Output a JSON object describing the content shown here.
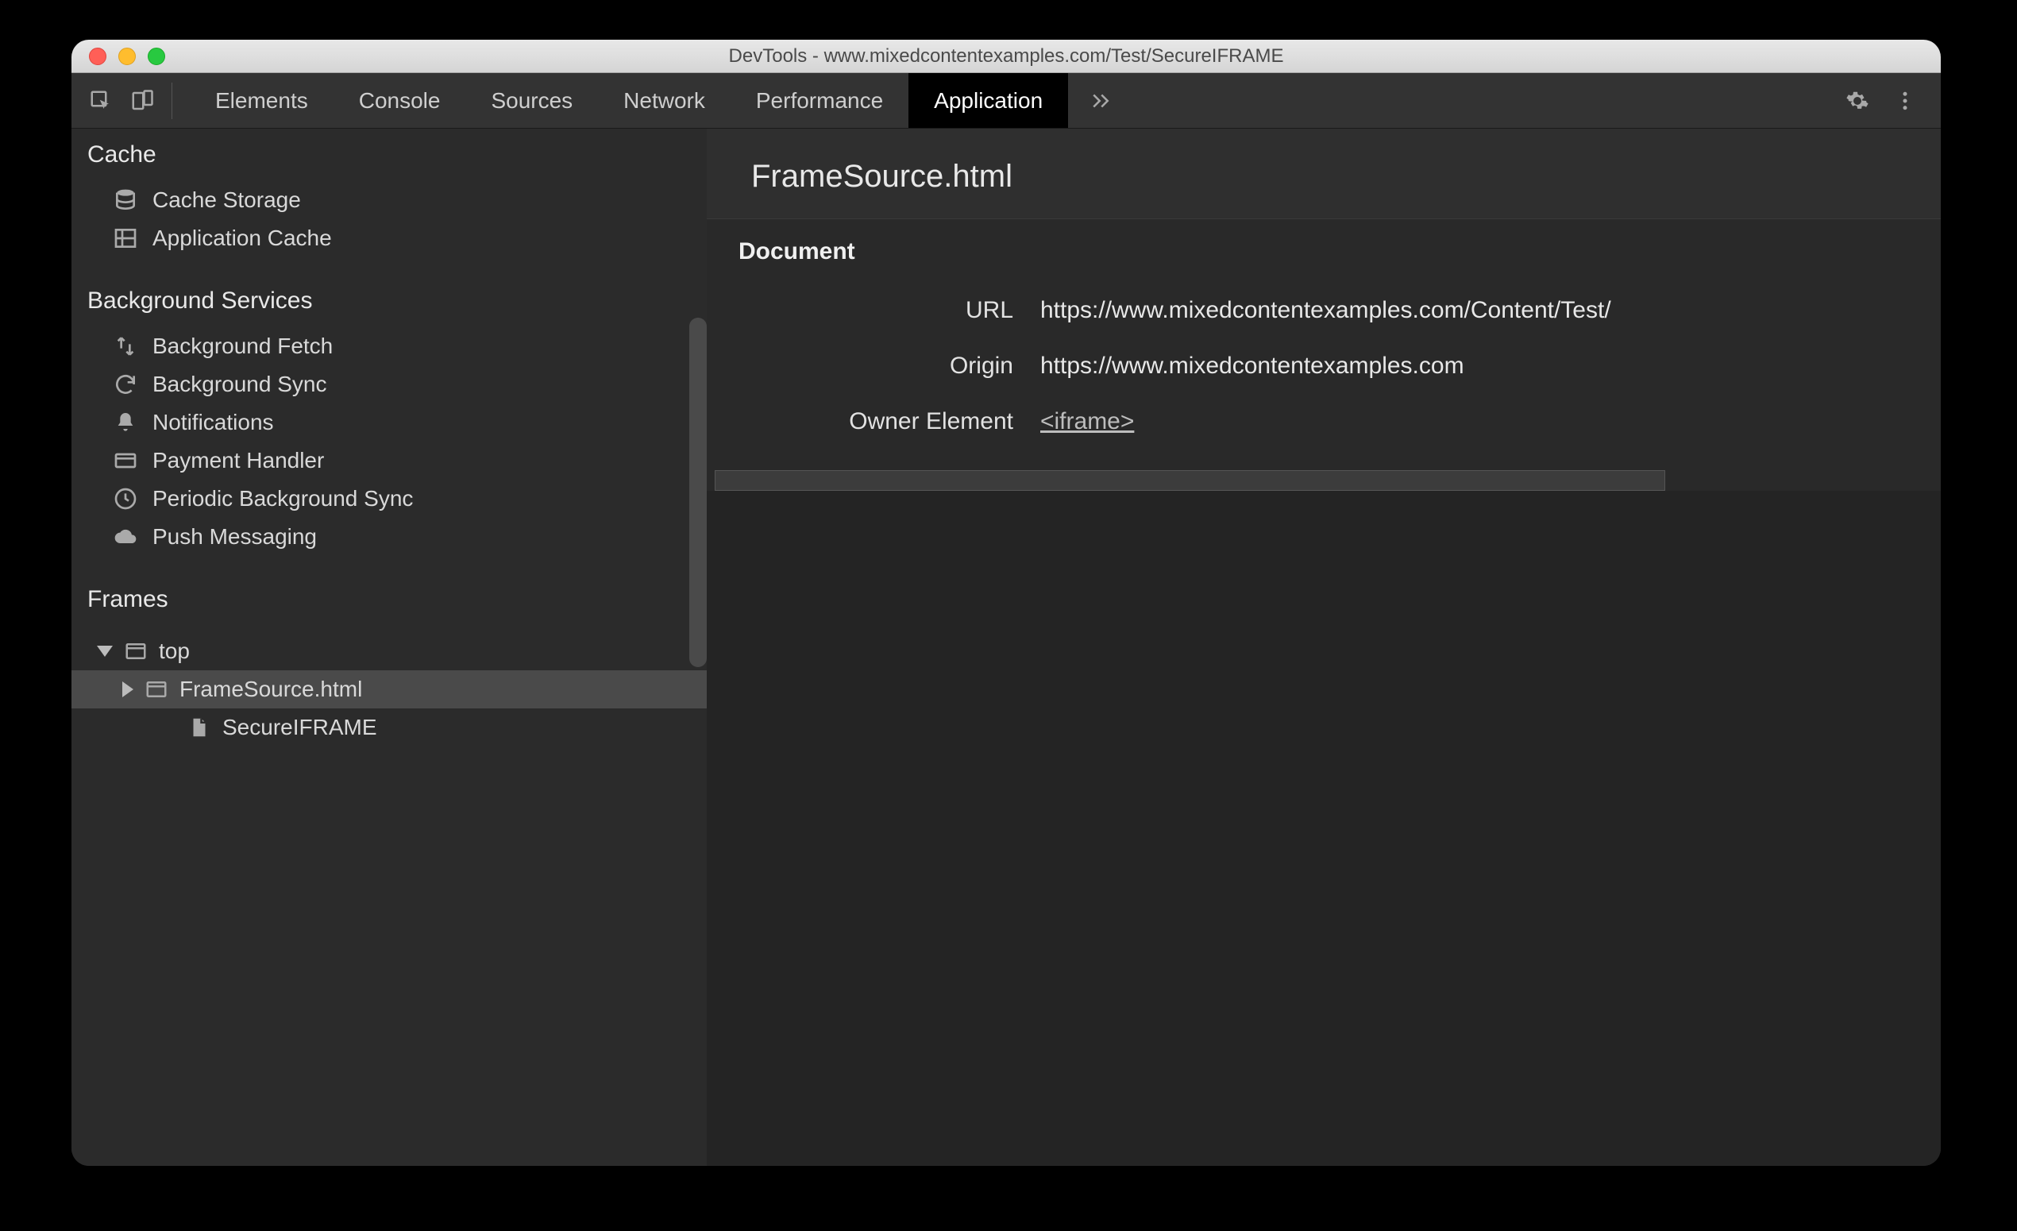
{
  "window": {
    "title": "DevTools - www.mixedcontentexamples.com/Test/SecureIFRAME"
  },
  "tabs": {
    "items": [
      "Elements",
      "Console",
      "Sources",
      "Network",
      "Performance",
      "Application"
    ],
    "active_index": 5
  },
  "sidebar": {
    "sections": [
      {
        "title": "Cache",
        "items": [
          {
            "icon": "database-icon",
            "label": "Cache Storage"
          },
          {
            "icon": "grid-icon",
            "label": "Application Cache"
          }
        ]
      },
      {
        "title": "Background Services",
        "items": [
          {
            "icon": "updown-icon",
            "label": "Background Fetch"
          },
          {
            "icon": "refresh-icon",
            "label": "Background Sync"
          },
          {
            "icon": "bell-icon",
            "label": "Notifications"
          },
          {
            "icon": "card-icon",
            "label": "Payment Handler"
          },
          {
            "icon": "clock-icon",
            "label": "Periodic Background Sync"
          },
          {
            "icon": "cloud-icon",
            "label": "Push Messaging"
          }
        ]
      },
      {
        "title": "Frames",
        "tree": [
          {
            "depth": 0,
            "expander": "down",
            "icon": "window-icon",
            "label": "top",
            "selected": false
          },
          {
            "depth": 1,
            "expander": "right",
            "icon": "window-icon",
            "label": "FrameSource.html",
            "selected": true
          },
          {
            "depth": 2,
            "expander": "none",
            "icon": "file-icon",
            "label": "SecureIFRAME",
            "selected": false
          }
        ]
      }
    ]
  },
  "main": {
    "heading": "FrameSource.html",
    "section_title": "Document",
    "rows": [
      {
        "key": "URL",
        "value": "https://www.mixedcontentexamples.com/Content/Test/",
        "link": false
      },
      {
        "key": "Origin",
        "value": "https://www.mixedcontentexamples.com",
        "link": false
      },
      {
        "key": "Owner Element",
        "value": "<iframe>",
        "link": true
      }
    ]
  }
}
